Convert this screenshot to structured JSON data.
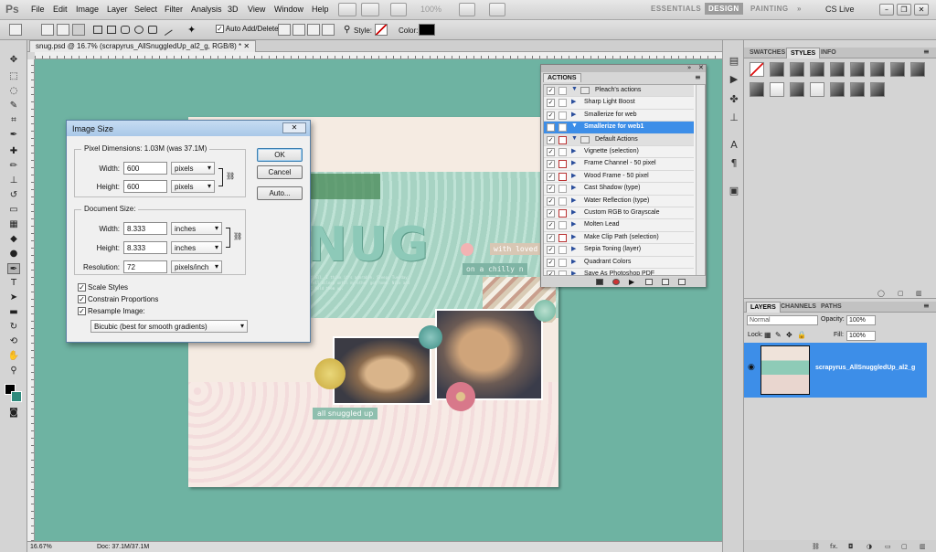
{
  "app": {
    "logo": "Ps"
  },
  "menu": [
    "File",
    "Edit",
    "Image",
    "Layer",
    "Select",
    "Filter",
    "Analysis",
    "3D",
    "View",
    "Window",
    "Help"
  ],
  "toolbar_zoom": "100%",
  "workspaces": {
    "essentials": "ESSENTIALS",
    "design": "DESIGN",
    "painting": "PAINTING",
    "more": "»",
    "cslive": "CS Live"
  },
  "options": {
    "auto_add_delete": "Auto Add/Delete",
    "style_label": "Style:",
    "color_label": "Color:",
    "color_value": "#000000"
  },
  "document": {
    "tab_title": "snug.psd @ 16.7% (scrapyrus_AllSnuggledUp_al2_g, RGB/8) *",
    "zoom": "16.67%",
    "doc_size": "Doc: 37.1M/37.1M",
    "canvas_bg": "#6eb3a2"
  },
  "artwork": {
    "headline": "NUG",
    "tagline": "with loved o",
    "tagline2": "on a chilly n",
    "stamp": "all snuggled up",
    "journal": "the snuggest of all. I think it's adorable. Sleepy Tuesday, and he always fell asleep until my other got home. Nice and snuggly after I hold them up."
  },
  "dialog": {
    "title": "Image Size",
    "close": "✕",
    "pixel_dimensions_label": "Pixel Dimensions: 1.03M (was 37.1M)",
    "width_label": "Width:",
    "width_px": "600",
    "height_label": "Height:",
    "height_px": "600",
    "pixel_unit": "pixels",
    "doc_size_label": "Document Size:",
    "doc_width": "8.333",
    "doc_height": "8.333",
    "doc_unit": "inches",
    "resolution_label": "Resolution:",
    "resolution": "72",
    "resolution_unit": "pixels/inch",
    "ok": "OK",
    "cancel": "Cancel",
    "auto": "Auto...",
    "scale_styles": "Scale Styles",
    "constrain": "Constrain Proportions",
    "resample": "Resample Image:",
    "resample_method": "Bicubic (best for smooth gradients)"
  },
  "actions": {
    "tab": "ACTIONS",
    "rows": [
      {
        "label": "Pleach's actions",
        "kind": "set",
        "red": false
      },
      {
        "label": "Sharp Light Boost",
        "kind": "action",
        "red": false
      },
      {
        "label": "Smallerize for web",
        "kind": "action",
        "red": false
      },
      {
        "label": "Smallerize for web1",
        "kind": "selected",
        "red": false
      },
      {
        "label": "Default Actions",
        "kind": "set",
        "red": true
      },
      {
        "label": "Vignette (selection)",
        "kind": "action",
        "red": false
      },
      {
        "label": "Frame Channel - 50 pixel",
        "kind": "action",
        "red": true
      },
      {
        "label": "Wood Frame - 50 pixel",
        "kind": "action",
        "red": true
      },
      {
        "label": "Cast Shadow (type)",
        "kind": "action",
        "red": false
      },
      {
        "label": "Water Reflection (type)",
        "kind": "action",
        "red": false
      },
      {
        "label": "Custom RGB to Grayscale",
        "kind": "action",
        "red": true
      },
      {
        "label": "Molten Lead",
        "kind": "action",
        "red": false
      },
      {
        "label": "Make Clip Path (selection)",
        "kind": "action",
        "red": true
      },
      {
        "label": "Sepia Toning (layer)",
        "kind": "action",
        "red": false
      },
      {
        "label": "Quadrant Colors",
        "kind": "action",
        "red": false
      },
      {
        "label": "Save As Photoshop PDF",
        "kind": "action",
        "red": false
      }
    ]
  },
  "styles_panel": {
    "tabs": [
      "SWATCHES",
      "STYLES",
      "INFO"
    ]
  },
  "layers_panel": {
    "tabs": [
      "LAYERS",
      "CHANNELS",
      "PATHS"
    ],
    "blend_mode": "Normal",
    "opacity_label": "Opacity:",
    "opacity": "100%",
    "lock_label": "Lock:",
    "fill_label": "Fill:",
    "fill": "100%",
    "layer_name": "scrapyrus_AllSnuggledUp_al2_g",
    "footer_fx": "fx."
  }
}
